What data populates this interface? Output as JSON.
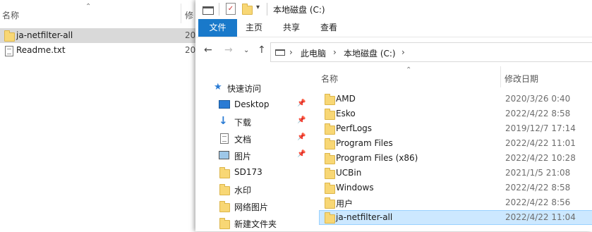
{
  "background_window": {
    "col_name": "名称",
    "col_modified": "修",
    "rows": [
      {
        "name": "ja-netfilter-all",
        "date": "20",
        "type": "folder",
        "selected": true
      },
      {
        "name": "Readme.txt",
        "date": "20",
        "type": "text",
        "selected": false
      }
    ]
  },
  "explorer": {
    "title": "本地磁盘 (C:)",
    "ribbon_tabs": [
      "文件",
      "主页",
      "共享",
      "查看"
    ],
    "breadcrumb": [
      "此电脑",
      "本地磁盘 (C:)"
    ],
    "nav": {
      "quick_access": "快速访问",
      "items": [
        {
          "label": "Desktop",
          "icon": "desktop-icon",
          "pinned": true
        },
        {
          "label": "下载",
          "icon": "download-icon",
          "pinned": true
        },
        {
          "label": "文档",
          "icon": "document-icon",
          "pinned": true
        },
        {
          "label": "图片",
          "icon": "picture-icon",
          "pinned": true
        },
        {
          "label": "SD173",
          "icon": "folder-icon",
          "pinned": false
        },
        {
          "label": "水印",
          "icon": "folder-icon",
          "pinned": false
        },
        {
          "label": "网络图片",
          "icon": "folder-icon",
          "pinned": false
        },
        {
          "label": "新建文件夹",
          "icon": "folder-icon",
          "pinned": false
        }
      ]
    },
    "columns": {
      "name": "名称",
      "modified": "修改日期"
    },
    "files": [
      {
        "name": "AMD",
        "date": "2020/3/26 0:40"
      },
      {
        "name": "Esko",
        "date": "2022/4/22 8:58"
      },
      {
        "name": "PerfLogs",
        "date": "2019/12/7 17:14"
      },
      {
        "name": "Program Files",
        "date": "2022/4/22 11:01"
      },
      {
        "name": "Program Files (x86)",
        "date": "2022/4/22 10:28"
      },
      {
        "name": "UCBin",
        "date": "2021/1/5 21:08"
      },
      {
        "name": "Windows",
        "date": "2022/4/22 8:58"
      },
      {
        "name": "用户",
        "date": "2022/4/22 8:56"
      },
      {
        "name": "ja-netfilter-all",
        "date": "2022/4/22 11:04",
        "selected": true
      }
    ]
  },
  "colors": {
    "accent": "#1979ca",
    "selection": "#cce8ff",
    "folder": "#f8d775"
  }
}
